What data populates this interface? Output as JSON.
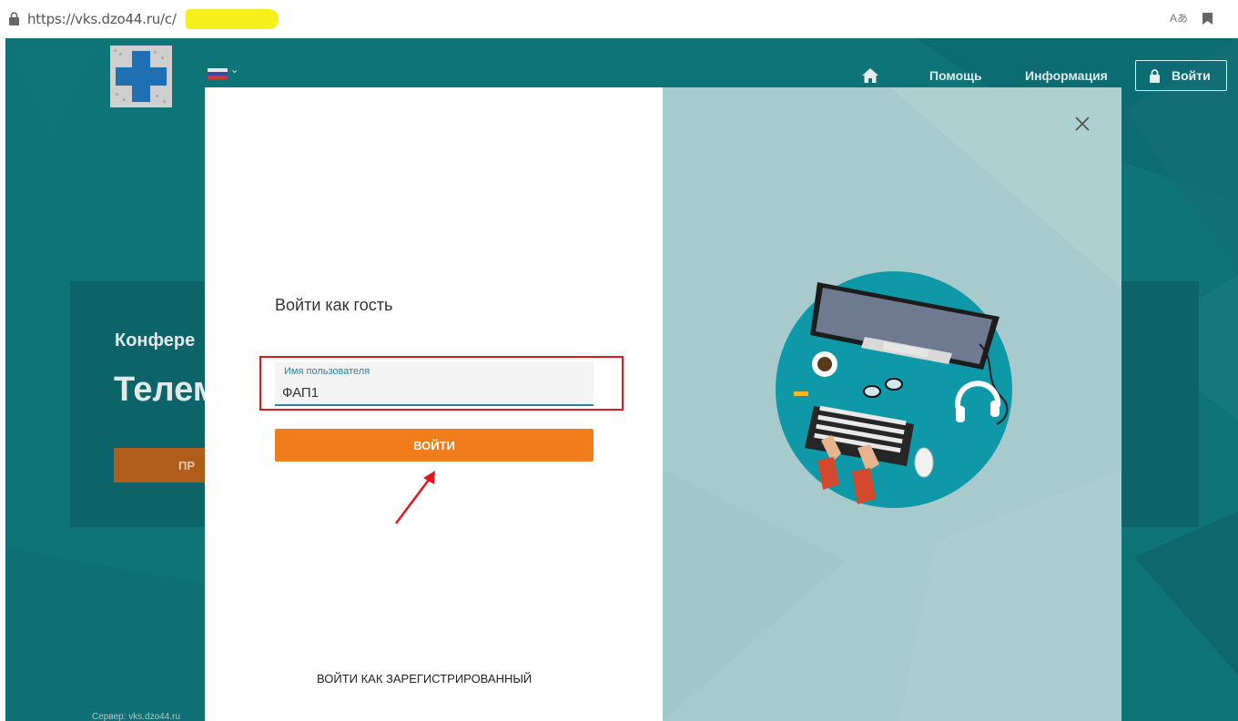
{
  "browser": {
    "url": "https://vks.dzo44.ru/c/",
    "translate_icon": "Aあ"
  },
  "header": {
    "nav": [
      {
        "label": "Помощь"
      },
      {
        "label": "Информация"
      }
    ],
    "login_label": "Войти",
    "icons": [
      "home-icon",
      "lock-icon",
      "flag-icon",
      "chevron-down-icon"
    ]
  },
  "background": {
    "subtitle": "Конфере",
    "title": "Телем",
    "button_label": "ПР",
    "server": "Сервер: vks.dzo44.ru"
  },
  "modal": {
    "title": "Войти как гость",
    "username": {
      "label": "Имя пользователя",
      "value": "ФАП1"
    },
    "submit_label": "ВОЙТИ",
    "registered_link": "ВОЙТИ КАК ЗАРЕГИСТРИРОВАННЫЙ"
  },
  "colors": {
    "page_bg": "#0f7478",
    "accent_orange": "#f07d19",
    "field_accent": "#2d7fa3",
    "annotation_red": "#e0181d",
    "url_highlight": "#f7ef1b"
  }
}
